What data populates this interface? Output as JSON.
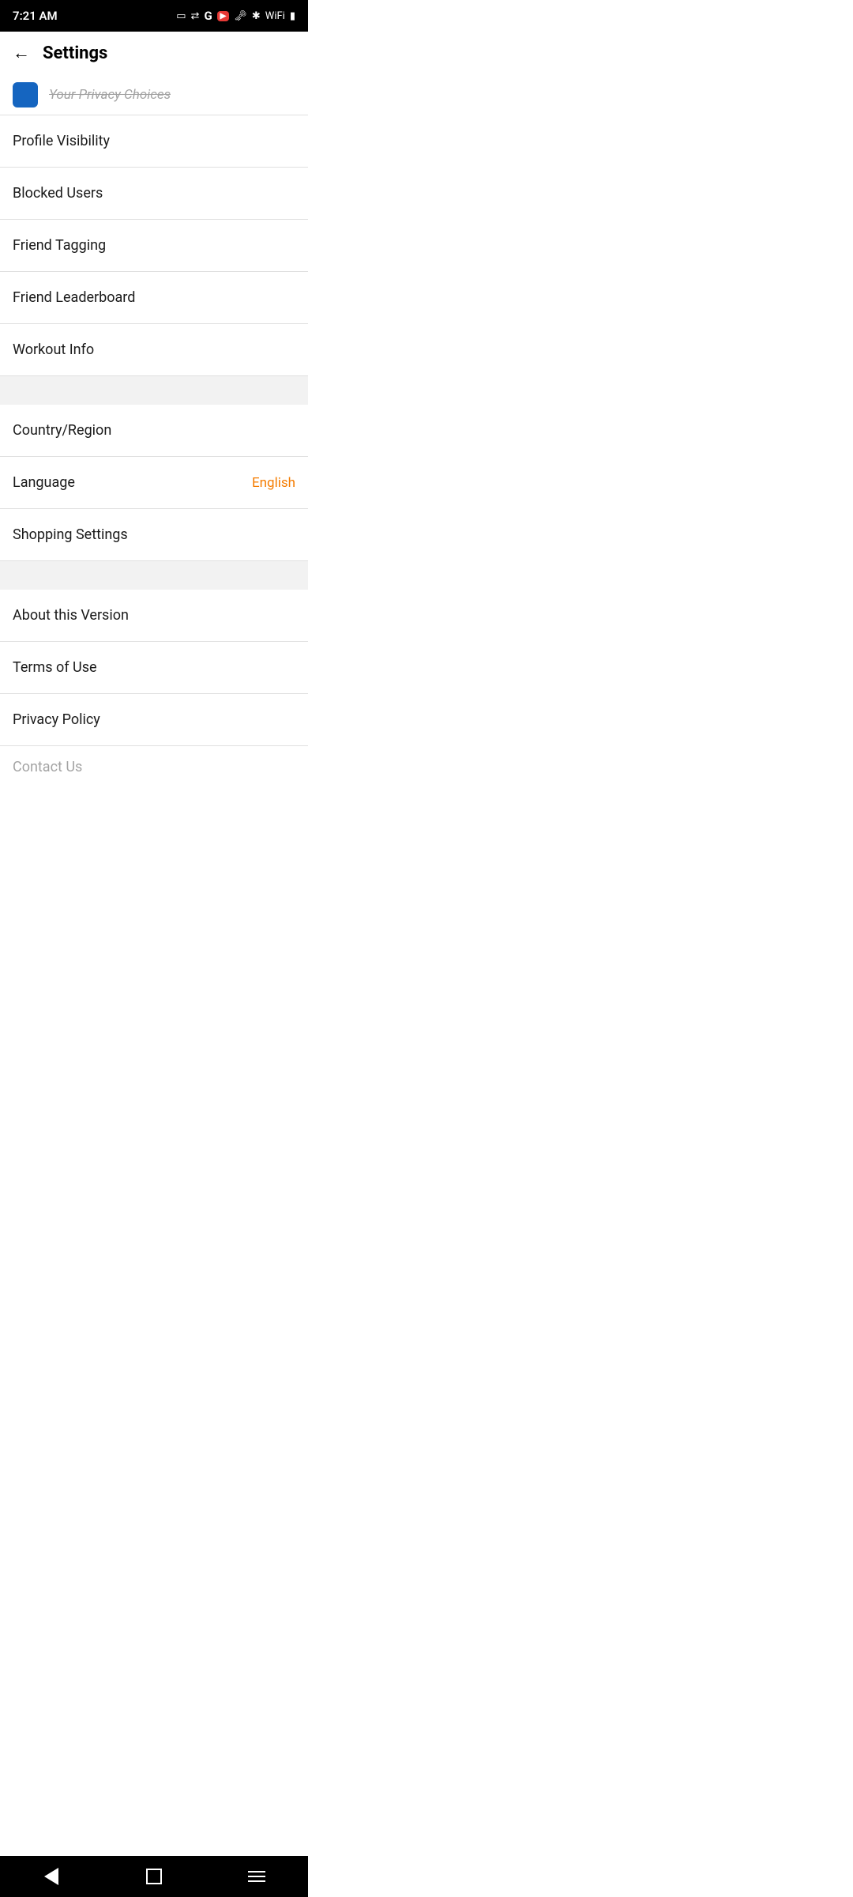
{
  "statusBar": {
    "time": "7:21 AM",
    "icons": [
      "camera",
      "video-icon",
      "key-icon",
      "bluetooth-icon",
      "wifi-icon",
      "battery-icon"
    ]
  },
  "header": {
    "backLabel": "←",
    "title": "Settings"
  },
  "partialItem": {
    "text": "Your Privacy Choices"
  },
  "settingsItems": [
    {
      "id": "profile-visibility",
      "label": "Profile Visibility",
      "value": ""
    },
    {
      "id": "blocked-users",
      "label": "Blocked Users",
      "value": ""
    },
    {
      "id": "friend-tagging",
      "label": "Friend Tagging",
      "value": ""
    },
    {
      "id": "friend-leaderboard",
      "label": "Friend Leaderboard",
      "value": ""
    },
    {
      "id": "workout-info",
      "label": "Workout Info",
      "value": ""
    }
  ],
  "settingsSection2": [
    {
      "id": "country-region",
      "label": "Country/Region",
      "value": ""
    },
    {
      "id": "language",
      "label": "Language",
      "value": "English"
    },
    {
      "id": "shopping-settings",
      "label": "Shopping Settings",
      "value": ""
    }
  ],
  "settingsSection3": [
    {
      "id": "about-version",
      "label": "About this Version",
      "value": ""
    },
    {
      "id": "terms-of-use",
      "label": "Terms of Use",
      "value": ""
    },
    {
      "id": "privacy-policy",
      "label": "Privacy Policy",
      "value": ""
    },
    {
      "id": "contact-us",
      "label": "Contact Us",
      "value": ""
    }
  ],
  "colors": {
    "accent": "#f57c00",
    "separator": "#f2f2f2",
    "divider": "#e0e0e0"
  }
}
